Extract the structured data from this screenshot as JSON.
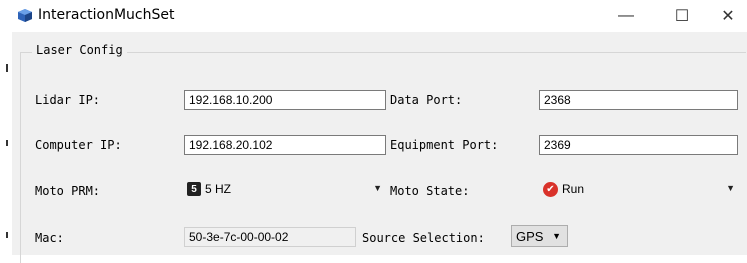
{
  "window": {
    "title": "InteractionMuchSet",
    "icon": "app-cube-icon",
    "controls": {
      "minimize": "—",
      "maximize": "☐",
      "close": "✕"
    }
  },
  "group": {
    "legend": "Laser Config"
  },
  "fields": {
    "lidar_ip": {
      "label": "Lidar IP:",
      "value": "192.168.10.200"
    },
    "data_port": {
      "label": "Data Port:",
      "value": "2368"
    },
    "computer_ip": {
      "label": "Computer IP:",
      "value": "192.168.20.102"
    },
    "equipment_port": {
      "label": "Equipment Port:",
      "value": "2369"
    },
    "moto_prm": {
      "label": "Moto PRM:",
      "badge": "5",
      "value": "5 HZ"
    },
    "moto_state": {
      "label": "Moto State:",
      "value": "Run"
    },
    "mac": {
      "label": "Mac:",
      "value": "50-3e-7c-00-00-02"
    },
    "source_selection": {
      "label": "Source Selection:",
      "value": "GPS"
    }
  },
  "colors": {
    "client_bg": "#f0f0f0",
    "run_icon": "#d9322a"
  }
}
